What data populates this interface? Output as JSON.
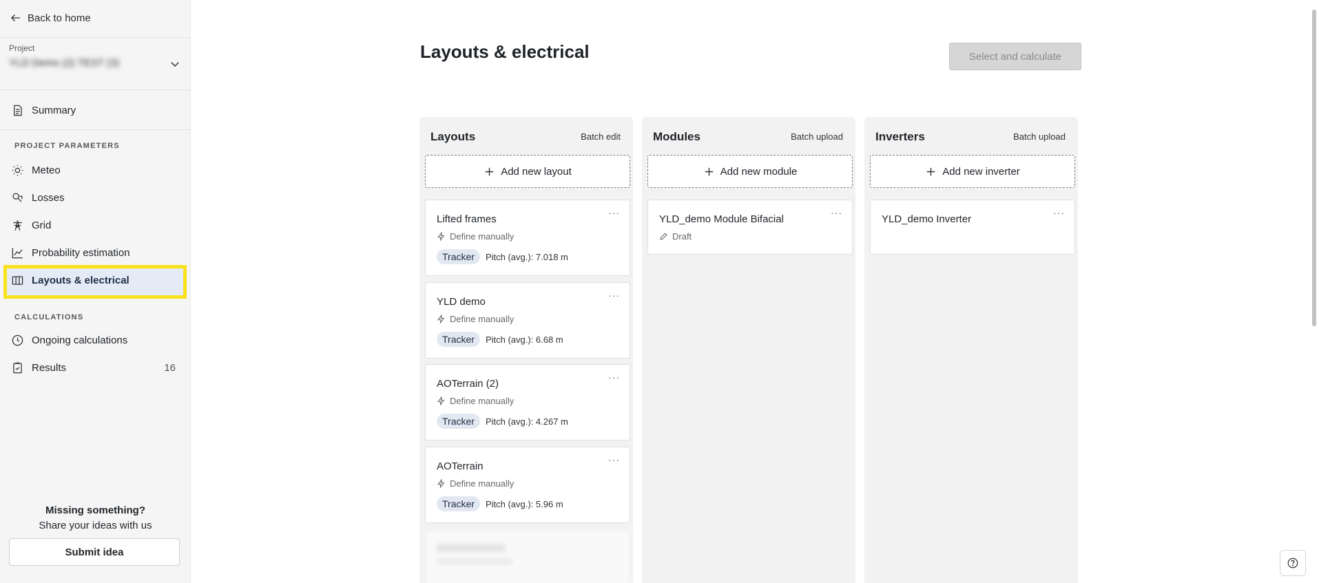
{
  "sidebar": {
    "back_label": "Back to home",
    "project_label": "Project",
    "project_name": "YLD Demo (2) TEST (3)",
    "items": [
      {
        "label": "Summary",
        "icon": "document-icon"
      },
      {
        "label": "Meteo",
        "icon": "sun-icon"
      },
      {
        "label": "Losses",
        "icon": "losses-icon"
      },
      {
        "label": "Grid",
        "icon": "pylon-icon"
      },
      {
        "label": "Probability estimation",
        "icon": "line-chart-icon"
      },
      {
        "label": "Layouts & electrical",
        "icon": "columns-icon",
        "active": true
      },
      {
        "label": "Ongoing calculations",
        "icon": "clock-icon"
      },
      {
        "label": "Results",
        "icon": "clipboard-icon",
        "count": "16"
      }
    ],
    "section_project_parameters": "PROJECT PARAMETERS",
    "section_calculations": "CALCULATIONS",
    "missing_title": "Missing something?",
    "missing_sub": "Share your ideas with us",
    "submit_label": "Submit idea",
    "highlight_color": "#f8e21b"
  },
  "main": {
    "title": "Layouts & electrical",
    "select_button": "Select and calculate",
    "columns": {
      "layouts": {
        "title": "Layouts",
        "action": "Batch edit",
        "add_label": "Add new layout",
        "cards": [
          {
            "name": "Lifted frames",
            "source": "Define manually",
            "tag": "Tracker",
            "pitch": "Pitch (avg.): 7.018 m"
          },
          {
            "name": "YLD demo",
            "source": "Define manually",
            "tag": "Tracker",
            "pitch": "Pitch (avg.): 6.68 m"
          },
          {
            "name": "AOTerrain (2)",
            "source": "Define manually",
            "tag": "Tracker",
            "pitch": "Pitch (avg.): 4.267 m"
          },
          {
            "name": "AOTerrain",
            "source": "Define manually",
            "tag": "Tracker",
            "pitch": "Pitch (avg.): 5.96 m"
          }
        ]
      },
      "modules": {
        "title": "Modules",
        "action": "Batch upload",
        "add_label": "Add new module",
        "cards": [
          {
            "name": "YLD_demo Module Bifacial",
            "status": "Draft"
          }
        ]
      },
      "inverters": {
        "title": "Inverters",
        "action": "Batch upload",
        "add_label": "Add new inverter",
        "cards": [
          {
            "name": "YLD_demo Inverter"
          }
        ]
      }
    },
    "card_menu": "···"
  }
}
